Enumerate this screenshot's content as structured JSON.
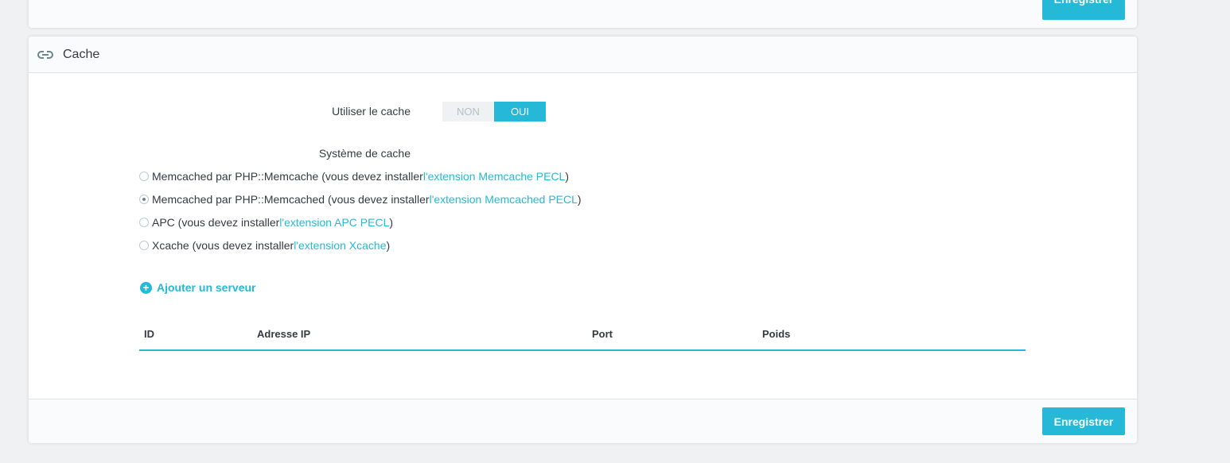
{
  "top_panel": {
    "save_label": "Enregistrer"
  },
  "panel": {
    "title": "Cache",
    "icon": "link-icon",
    "use_cache": {
      "label": "Utiliser le cache",
      "off": "NON",
      "on": "OUI",
      "value": "OUI"
    },
    "cache_system": {
      "label": "Système de cache",
      "options": [
        {
          "text": "Memcached par PHP::Memcache (vous devez installer ",
          "link": "l'extension Memcache PECL",
          "suffix": ")",
          "checked": false
        },
        {
          "text": "Memcached par PHP::Memcached (vous devez installer ",
          "link": "l'extension Memcached PECL",
          "suffix": ")",
          "checked": true
        },
        {
          "text": "APC (vous devez installer ",
          "link": "l'extension APC PECL",
          "suffix": ")",
          "checked": false
        },
        {
          "text": "Xcache (vous devez installer ",
          "link": "l'extension Xcache",
          "suffix": ")",
          "checked": false
        }
      ]
    },
    "add_server": {
      "label": "Ajouter un serveur",
      "icon": "plus-circle-icon"
    },
    "servers_table": {
      "columns": [
        "ID",
        "Adresse IP",
        "Port",
        "Poids"
      ],
      "rows": []
    },
    "save_label": "Enregistrer"
  },
  "colors": {
    "accent": "#25b9d7",
    "background": "#eff1f2",
    "text": "#363a41"
  }
}
